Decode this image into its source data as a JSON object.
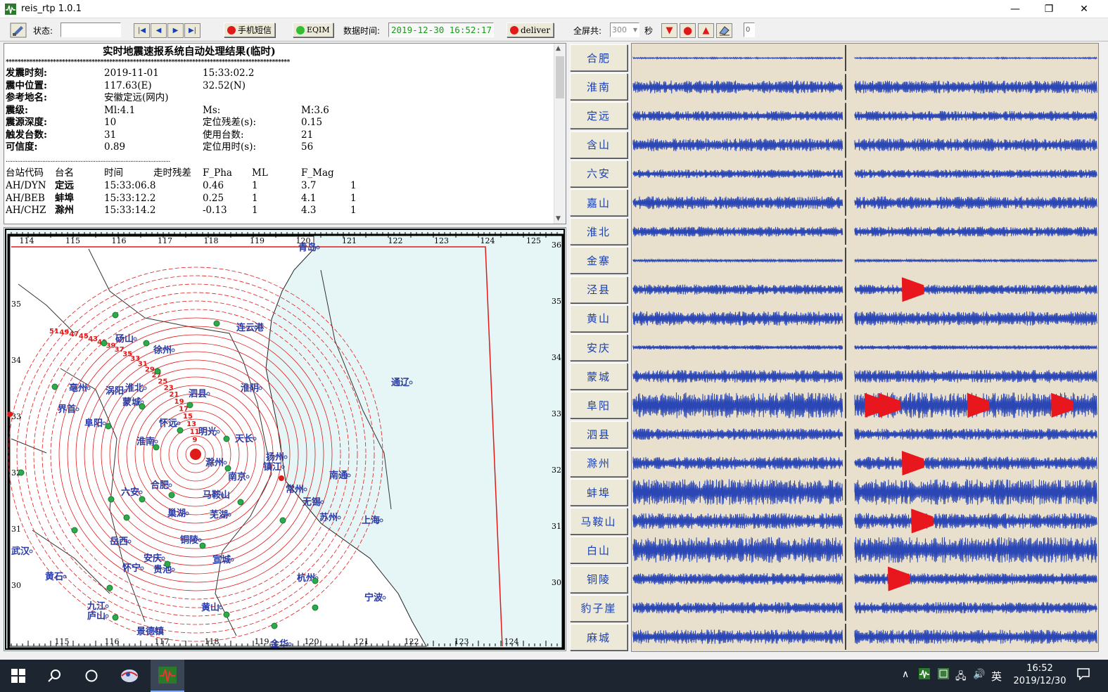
{
  "window": {
    "title": "reis_rtp 1.0.1",
    "minimize": "—",
    "maximize": "❐",
    "close": "✕"
  },
  "toolbar": {
    "status_label": "状态:",
    "status_value": "",
    "sms_button": "手机短信",
    "eqim_button": "EQIM",
    "data_time_label": "数据时间:",
    "data_time_value": "2019-12-30 16:52:17",
    "deliver_button": "deliver",
    "fullscreen_label": "全屏共:",
    "fullscreen_value": "300",
    "seconds_label": "秒",
    "counter_value": "0",
    "colors": {
      "red": "#e01919",
      "green": "#2fbf2f",
      "time_text": "#1a9a1a"
    }
  },
  "report": {
    "heading": "实时地震速报系统自动处理结果(临时)",
    "separator": "************************************************************************************************",
    "rows": [
      [
        "发震时刻:",
        "2019-11-01",
        "15:33:02.2",
        ""
      ],
      [
        "震中位置:",
        "117.63(E)",
        "32.52(N)",
        ""
      ],
      [
        "参考地名:",
        "安徽定远(网内)",
        "",
        ""
      ],
      [
        "震级:",
        "Ml:4.1",
        "Ms:",
        "M:3.6"
      ],
      [
        "震源深度:",
        "10",
        "定位残差(s):",
        "0.15"
      ],
      [
        "触发台数:",
        "31",
        "使用台数:",
        "21"
      ],
      [
        "可信度:",
        "0.89",
        "定位用时(s):",
        "56"
      ]
    ],
    "dotted": "...................................................................................................",
    "table_header": [
      "台站代码",
      "台名",
      "时间",
      "走时残差",
      "F_Pha",
      "ML",
      "F_Mag",
      ""
    ],
    "table_rows": [
      [
        "AH/DYN",
        "定远",
        "15:33:06.8",
        "0.46",
        "1",
        "3.7",
        "1"
      ],
      [
        "AH/BEB",
        "蚌埠",
        "15:33:12.2",
        "0.25",
        "1",
        "4.1",
        "1"
      ],
      [
        "AH/CHZ",
        "滁州",
        "15:33:14.2",
        "-0.13",
        "1",
        "4.3",
        "1"
      ]
    ]
  },
  "map": {
    "top_ticks": [
      "114",
      "115",
      "116",
      "117",
      "118",
      "119",
      "120",
      "121",
      "122",
      "123",
      "124",
      "125"
    ],
    "bottom_ticks": [
      "115",
      "116",
      "117",
      "118",
      "119",
      "120",
      "121",
      "122",
      "123",
      "124"
    ],
    "left_ticks": [
      "35",
      "34",
      "33",
      "32",
      "31",
      "30"
    ],
    "right_ticks": [
      "36",
      "35",
      "34",
      "33",
      "32",
      "31",
      "30"
    ],
    "ring_labels": [
      "51",
      "49",
      "47",
      "45",
      "43",
      "41",
      "39",
      "37",
      "35",
      "33",
      "31",
      "29",
      "27",
      "25",
      "23",
      "21",
      "19",
      "17",
      "15",
      "13",
      "11",
      "9"
    ],
    "cities": [
      "青岛",
      "连云港",
      "砀山",
      "徐州",
      "淮阴",
      "通辽",
      "亳州",
      "涡阳",
      "淮北",
      "泗县",
      "界首",
      "蒙城",
      "阜阳",
      "怀远",
      "明光",
      "淮南",
      "天长",
      "滁州",
      "扬州",
      "镇江",
      "南京",
      "南通",
      "六安",
      "合肥",
      "常州",
      "马鞍山",
      "无锡",
      "巢湖",
      "芜湖",
      "苏州",
      "上海",
      "岳西",
      "铜陵",
      "武汉",
      "安庆",
      "宣城",
      "怀宁",
      "贵池",
      "杭州",
      "黄石",
      "宁波",
      "九江",
      "庐山",
      "黄山",
      "景德镇",
      "金华"
    ],
    "colors": {
      "sea": "#e6f5f5",
      "land": "#ffffff",
      "ring": "#e01919",
      "city": "#2b3aa0",
      "station": "#2faa4a"
    }
  },
  "stations": [
    "合肥",
    "淮南",
    "定远",
    "含山",
    "六安",
    "嘉山",
    "淮北",
    "金寨",
    "泾县",
    "黄山",
    "安庆",
    "蒙城",
    "阜阳",
    "泗县",
    "滁州",
    "蚌埠",
    "马鞍山",
    "白山",
    "铜陵",
    "豹子崖",
    "麻城"
  ],
  "waves": {
    "background": "#e8e0cd",
    "trace_color": "#2b47b5",
    "pick_color": "#e8171d",
    "amplitudes": [
      0.05,
      0.45,
      0.35,
      0.45,
      0.3,
      0.45,
      0.35,
      0.1,
      0.35,
      0.5,
      0.15,
      0.45,
      0.9,
      0.4,
      0.45,
      0.9,
      0.55,
      0.9,
      0.4,
      0.4,
      0.5
    ],
    "red_bursts": [
      [],
      [],
      [],
      [],
      [],
      [],
      [],
      [],
      [
        0.58
      ],
      [],
      [],
      [],
      [
        0.5,
        0.53,
        0.72,
        0.9
      ],
      [],
      [
        0.58
      ],
      [],
      [
        0.6
      ],
      [],
      [
        0.55
      ],
      [],
      []
    ]
  },
  "taskbar": {
    "time": "16:52",
    "date": "2019/12/30",
    "ime": "英"
  }
}
